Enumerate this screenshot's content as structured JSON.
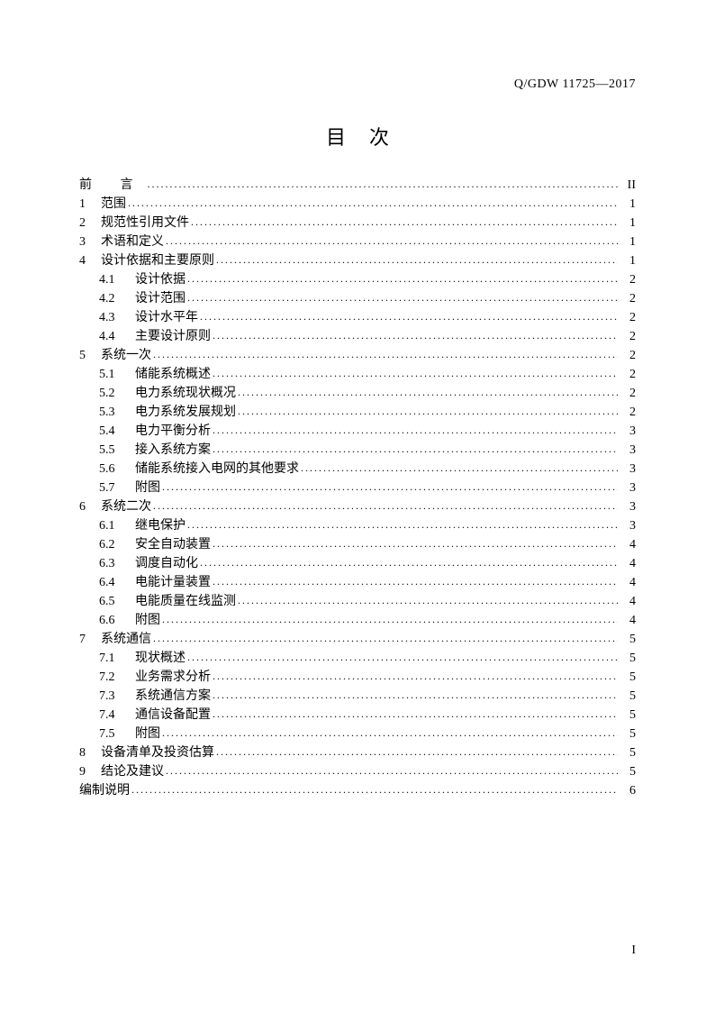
{
  "header_code": "Q/GDW 11725—2017",
  "title": "目次",
  "page_number": "I",
  "toc": [
    {
      "num": "",
      "label": "前  言",
      "page": "II",
      "level": 1,
      "preface": true
    },
    {
      "num": "1",
      "label": "范围",
      "page": "1",
      "level": 1
    },
    {
      "num": "2",
      "label": "规范性引用文件",
      "page": "1",
      "level": 1
    },
    {
      "num": "3",
      "label": "术语和定义",
      "page": "1",
      "level": 1
    },
    {
      "num": "4",
      "label": "设计依据和主要原则",
      "page": "1",
      "level": 1
    },
    {
      "num": "4.1",
      "label": "设计依据",
      "page": "2",
      "level": 2
    },
    {
      "num": "4.2",
      "label": "设计范围",
      "page": "2",
      "level": 2
    },
    {
      "num": "4.3",
      "label": "设计水平年",
      "page": "2",
      "level": 2
    },
    {
      "num": "4.4",
      "label": "主要设计原则",
      "page": "2",
      "level": 2
    },
    {
      "num": "5",
      "label": "系统一次",
      "page": "2",
      "level": 1
    },
    {
      "num": "5.1",
      "label": "储能系统概述",
      "page": "2",
      "level": 2
    },
    {
      "num": "5.2",
      "label": "电力系统现状概况",
      "page": "2",
      "level": 2
    },
    {
      "num": "5.3",
      "label": "电力系统发展规划",
      "page": "2",
      "level": 2
    },
    {
      "num": "5.4",
      "label": "电力平衡分析",
      "page": "3",
      "level": 2
    },
    {
      "num": "5.5",
      "label": "接入系统方案",
      "page": "3",
      "level": 2
    },
    {
      "num": "5.6",
      "label": "储能系统接入电网的其他要求",
      "page": "3",
      "level": 2
    },
    {
      "num": "5.7",
      "label": "附图",
      "page": "3",
      "level": 2
    },
    {
      "num": "6",
      "label": "系统二次",
      "page": "3",
      "level": 1
    },
    {
      "num": "6.1",
      "label": "继电保护",
      "page": "3",
      "level": 2
    },
    {
      "num": "6.2",
      "label": "安全自动装置",
      "page": "4",
      "level": 2
    },
    {
      "num": "6.3",
      "label": "调度自动化",
      "page": "4",
      "level": 2
    },
    {
      "num": "6.4",
      "label": "电能计量装置",
      "page": "4",
      "level": 2
    },
    {
      "num": "6.5",
      "label": "电能质量在线监测",
      "page": "4",
      "level": 2
    },
    {
      "num": "6.6",
      "label": "附图",
      "page": "4",
      "level": 2
    },
    {
      "num": "7",
      "label": "系统通信",
      "page": "5",
      "level": 1
    },
    {
      "num": "7.1",
      "label": "现状概述",
      "page": "5",
      "level": 2
    },
    {
      "num": "7.2",
      "label": "业务需求分析",
      "page": "5",
      "level": 2
    },
    {
      "num": "7.3",
      "label": "系统通信方案",
      "page": "5",
      "level": 2
    },
    {
      "num": "7.4",
      "label": "通信设备配置",
      "page": "5",
      "level": 2
    },
    {
      "num": "7.5",
      "label": "附图",
      "page": "5",
      "level": 2
    },
    {
      "num": "8",
      "label": "设备清单及投资估算",
      "page": "5",
      "level": 1
    },
    {
      "num": "9",
      "label": "结论及建议",
      "page": "5",
      "level": 1
    },
    {
      "num": "",
      "label": "编制说明",
      "page": "6",
      "level": 1
    }
  ]
}
